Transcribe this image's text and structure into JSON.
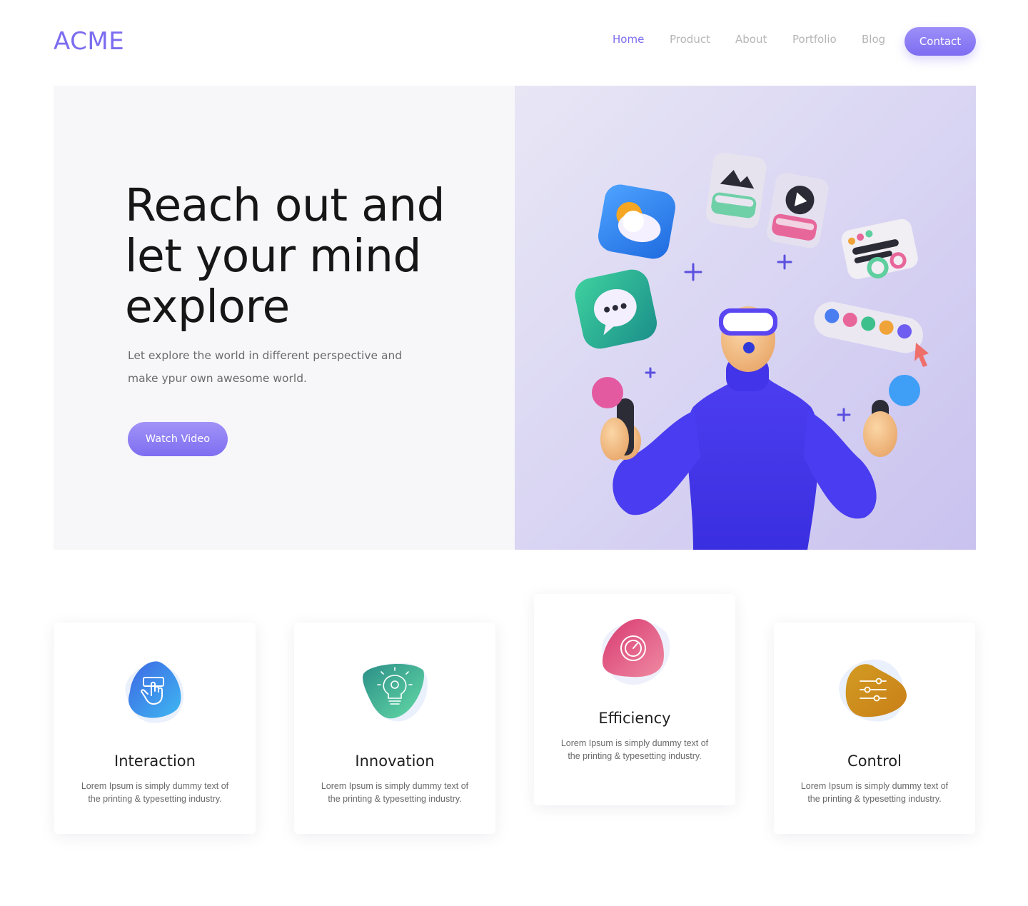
{
  "header": {
    "logo": "ACME",
    "nav": [
      "Home",
      "Product",
      "About",
      "Portfolio",
      "Blog"
    ],
    "active": "Home",
    "contact_label": "Contact"
  },
  "hero": {
    "title": "Reach out and let your mind explore",
    "subtitle": "Let explore the world in different perspective and make ypur own awesome world.",
    "cta_label": "Watch Video",
    "illustration": "vr-person-with-floating-app-icons"
  },
  "features": [
    {
      "title": "Interaction",
      "text": "Lorem Ipsum is simply dummy text of the printing & typesetting industry.",
      "icon": "touch-icon",
      "colors": [
        "#4a7de8",
        "#3fb4ee"
      ]
    },
    {
      "title": "Innovation",
      "text": "Lorem Ipsum is simply dummy text of the printing & typesetting industry.",
      "icon": "lightbulb-gear-icon",
      "colors": [
        "#2b9b8e",
        "#62d9a7"
      ]
    },
    {
      "title": "Efficiency",
      "text": "Lorem Ipsum is simply dummy text of the printing & typesetting industry.",
      "icon": "speedometer-icon",
      "colors": [
        "#d93f73",
        "#ef7f9b"
      ]
    },
    {
      "title": "Control",
      "text": "Lorem Ipsum is simply dummy text of the printing & typesetting industry.",
      "icon": "sliders-icon",
      "colors": [
        "#c98a16",
        "#e8b83a"
      ]
    }
  ],
  "colors": {
    "accent": "#7b6cf0"
  }
}
